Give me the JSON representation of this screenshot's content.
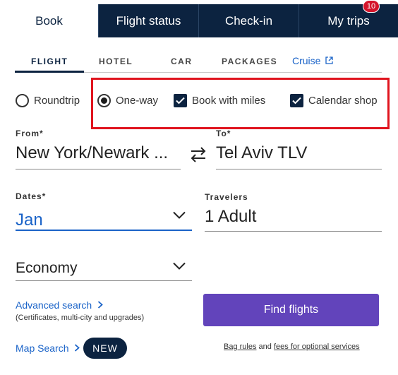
{
  "top_tabs": [
    {
      "label": "Book",
      "active": true
    },
    {
      "label": "Flight status"
    },
    {
      "label": "Check-in"
    },
    {
      "label": "My trips",
      "badge": "10"
    }
  ],
  "product_tabs": [
    {
      "label": "FLIGHT",
      "active": true
    },
    {
      "label": "HOTEL"
    },
    {
      "label": "CAR"
    },
    {
      "label": "PACKAGES"
    }
  ],
  "cruise_link": "Cruise",
  "trip_options": {
    "roundtrip": {
      "label": "Roundtrip",
      "checked": false
    },
    "oneway": {
      "label": "One-way",
      "checked": true
    },
    "book_with_miles": {
      "label": "Book with miles",
      "checked": true
    },
    "calendar_shop": {
      "label": "Calendar shop",
      "checked": true
    }
  },
  "from": {
    "label": "From*",
    "value": "New York/Newark ..."
  },
  "to": {
    "label": "To*",
    "value": "Tel Aviv TLV"
  },
  "dates": {
    "label": "Dates*",
    "value": "Jan"
  },
  "travelers": {
    "label": "Travelers",
    "value": "1 Adult"
  },
  "cabin": {
    "value": "Economy"
  },
  "find_flights": "Find flights",
  "advanced_search": {
    "label": "Advanced search",
    "note": "(Certificates, multi-city and upgrades)"
  },
  "map_search": {
    "label": "Map Search",
    "badge": "NEW"
  },
  "bag_rules": {
    "link1": "Bag rules",
    "conj": "and",
    "link2": "fees for optional services"
  },
  "colors": {
    "navy": "#0c2340",
    "purple": "#6244bb",
    "link": "#1a63c8",
    "highlight": "#e0141e"
  }
}
